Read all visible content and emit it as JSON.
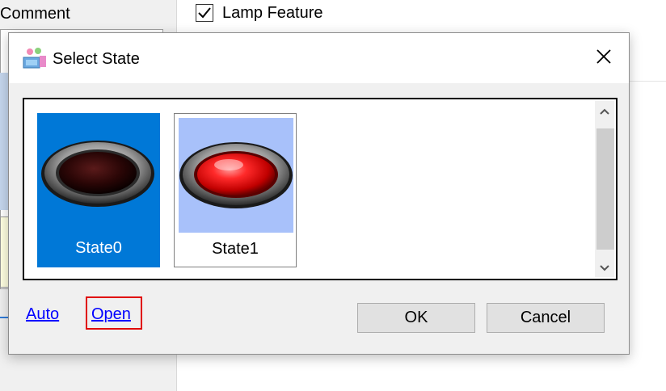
{
  "background": {
    "comment_label": "Comment",
    "lamp_feature_label": "Lamp Feature",
    "lamp_feature_checked": true
  },
  "dialog": {
    "title": "Select State",
    "icon": "app-states-icon",
    "close_icon": "close-icon",
    "states": [
      {
        "label": "State0",
        "selected": true,
        "lamp": "dark-red-lamp"
      },
      {
        "label": "State1",
        "selected": false,
        "lamp": "bright-red-lamp"
      }
    ],
    "links": {
      "auto": "Auto",
      "open": "Open"
    },
    "buttons": {
      "ok": "OK",
      "cancel": "Cancel"
    },
    "colors": {
      "selection": "#0078d7",
      "highlight": "#e00000",
      "link": "#0000ff"
    }
  }
}
